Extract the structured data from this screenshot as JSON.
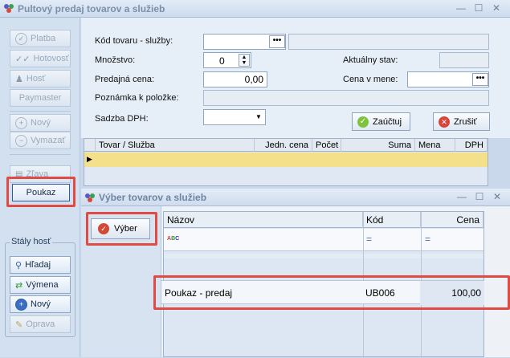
{
  "window": {
    "title": "Pultový predaj tovarov a služieb",
    "controls": [
      "minimize",
      "maximize",
      "close"
    ]
  },
  "sidebar": {
    "buttons": [
      {
        "label": "Platba",
        "icon": "check-circle-icon"
      },
      {
        "label": "Hotovosť",
        "icon": "double-check-icon"
      },
      {
        "label": "Hosť",
        "icon": "person-icon"
      },
      {
        "label": "Paymaster",
        "icon": ""
      },
      {
        "label": "Nový",
        "icon": "plus-circle-icon"
      },
      {
        "label": "Vymazať",
        "icon": "minus-circle-icon"
      },
      {
        "label": "Zľava",
        "icon": "discount-icon"
      },
      {
        "label": "Poukaz",
        "icon": ""
      }
    ],
    "guest_group": {
      "title": "Stály hosť",
      "buttons": [
        {
          "label": "Hľadaj",
          "icon": "search-people-icon"
        },
        {
          "label": "Výmena",
          "icon": "exchange-icon"
        },
        {
          "label": "Nový",
          "icon": "plus-circle-icon"
        },
        {
          "label": "Oprava",
          "icon": "pencil-icon"
        }
      ]
    }
  },
  "form": {
    "kod_label": "Kód tovaru  - služby:",
    "kod_value": "",
    "kod_name": "",
    "mnozstvo_label": "Množstvo:",
    "mnozstvo_value": "0",
    "aktualny_label": "Aktuálny stav:",
    "aktualny_value": "",
    "cena_label": "Predajná cena:",
    "cena_value": "0,00",
    "cena_mene_label": "Cena v mene:",
    "cena_mene_value": "",
    "poznamka_label": "Poznámka k položke:",
    "poznamka_value": "",
    "dph_label": "Sadzba DPH:",
    "dph_value": "",
    "zauctuj_label": "Zaúčtuj",
    "zrusit_label": "Zrušiť"
  },
  "grid": {
    "columns": [
      "Tovar / Služba",
      "Jedn. cena",
      "Počet",
      "Suma",
      "Mena",
      "DPH"
    ]
  },
  "dialog": {
    "title": "Výber tovarov a služieb",
    "select_button": "Výber",
    "columns": [
      "Názov",
      "Kód",
      "Cena"
    ],
    "filter_row": {
      "nazov": "",
      "kod": "=",
      "cena": "="
    },
    "rows": [
      {
        "nazov": "Poukaz - predaj",
        "kod": "UB006",
        "cena": "100,00"
      }
    ]
  },
  "colors": {
    "highlight": "#e04c43",
    "selected_row": "#f4e08a",
    "accent": "#2d5da1"
  }
}
